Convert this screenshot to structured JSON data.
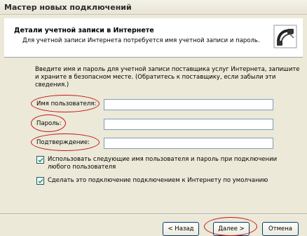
{
  "window": {
    "title": "Мастер новых подключений"
  },
  "header": {
    "title": "Детали учетной записи в Интернете",
    "subtitle": "Для учетной записи Интернета потребуется имя учетной записи и пароль."
  },
  "intro": "Введите имя и пароль для учетной записи поставщика услуг Интернета, запишите и храните в безопасном месте. (Обратитесь к поставщику, если забыли эти сведения.)",
  "fields": {
    "username": {
      "label": "Имя пользователя:",
      "value": ""
    },
    "password": {
      "label": "Пароль:",
      "value": ""
    },
    "confirm": {
      "label": "Подтверждение:",
      "value": ""
    }
  },
  "options": {
    "use_for_all": {
      "label": "Использовать следующие имя пользователя и пароль при подключении любого пользователя",
      "checked": true
    },
    "default_connection": {
      "label": "Сделать это подключение подключением к Интернету по умолчанию",
      "checked": true
    }
  },
  "buttons": {
    "back": "< Назад",
    "next": "Далее >",
    "cancel": "Отмена"
  },
  "colors": {
    "annotation": "#c21818",
    "check": "#21a121"
  },
  "icons": {
    "wizard": "connection-wizard-icon",
    "checkmark": "checkmark-icon"
  }
}
